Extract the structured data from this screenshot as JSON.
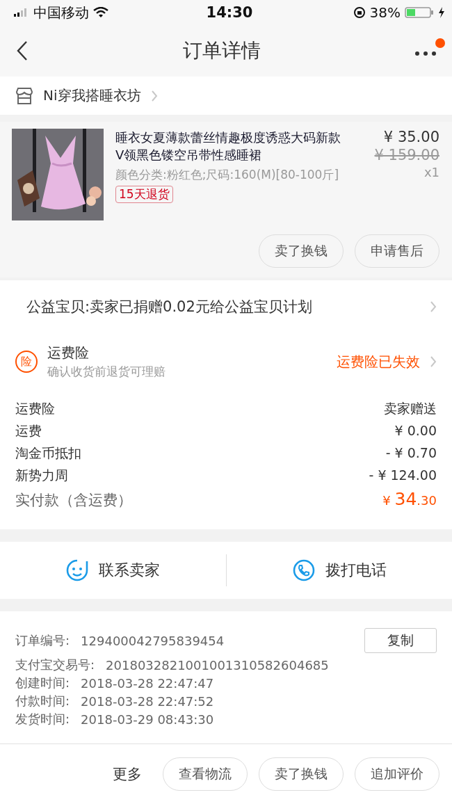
{
  "status_bar": {
    "carrier": "中国移动",
    "time": "14:30",
    "battery": "38%"
  },
  "nav": {
    "title": "订单详情",
    "notification_dot": true
  },
  "shop": {
    "name": "Ni穿我搭睡衣坊"
  },
  "product": {
    "kind": "picture",
    "title": "睡衣女夏薄款蕾丝情趣极度诱惑大码新款V领黑色镂空吊带性感睡裙",
    "spec": "颜色分类:粉红色;尺码:160(M)[80-100斤]",
    "tag": "15天退货",
    "price": "¥ 35.00",
    "original_price": "¥ 159.00",
    "quantity": "x1",
    "buttons": [
      "卖了换钱",
      "申请售后"
    ]
  },
  "charity": {
    "text": "公益宝贝:卖家已捐赠0.02元给公益宝贝计划"
  },
  "insurance": {
    "icon_char": "险",
    "title": "运费险",
    "subtitle": "确认收货前退货可理赔",
    "status": "运费险已失效"
  },
  "fees": [
    {
      "label": "运费险",
      "value": "卖家赠送"
    },
    {
      "label": "运费",
      "value": "¥ 0.00"
    },
    {
      "label": "淘金币抵扣",
      "value": "- ¥ 0.70"
    },
    {
      "label": "新势力周",
      "value": "- ¥ 124.00"
    }
  ],
  "total": {
    "label": "实付款（含运费）",
    "currency": "¥",
    "integer": "34",
    "decimal": ".30"
  },
  "contact": [
    {
      "kind": "chat",
      "label": "联系卖家"
    },
    {
      "kind": "phone",
      "label": "拨打电话"
    }
  ],
  "info": {
    "copy_button": "复制",
    "rows": [
      {
        "label": "订单编号:",
        "value": "129400042795839454"
      },
      {
        "label": "支付宝交易号:",
        "value": "2018032821001001310582604685"
      },
      {
        "label": "创建时间:",
        "value": "2018-03-28 22:47:47"
      },
      {
        "label": "付款时间:",
        "value": "2018-03-28 22:47:52"
      },
      {
        "label": "发货时间:",
        "value": "2018-03-29 08:43:30"
      }
    ]
  },
  "bottom_bar": {
    "more": "更多",
    "buttons": [
      "查看物流",
      "卖了换钱",
      "追加评价"
    ]
  }
}
